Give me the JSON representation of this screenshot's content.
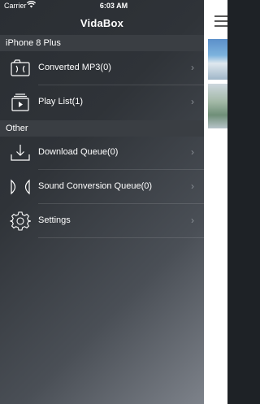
{
  "status_bar": {
    "carrier": "Carrier",
    "time": "6:03 AM"
  },
  "app": {
    "title": "VidaBox"
  },
  "sections": [
    {
      "header": "iPhone 8 Plus",
      "items": [
        {
          "label": "Converted MP3(0)",
          "icon": "music-icon"
        },
        {
          "label": "Play List(1)",
          "icon": "playlist-icon"
        }
      ]
    },
    {
      "header": "Other",
      "items": [
        {
          "label": "Download Queue(0)",
          "icon": "download-icon"
        },
        {
          "label": "Sound Conversion Queue(0)",
          "icon": "conversion-icon"
        },
        {
          "label": "Settings",
          "icon": "gear-icon"
        }
      ]
    }
  ],
  "chevron": "›"
}
